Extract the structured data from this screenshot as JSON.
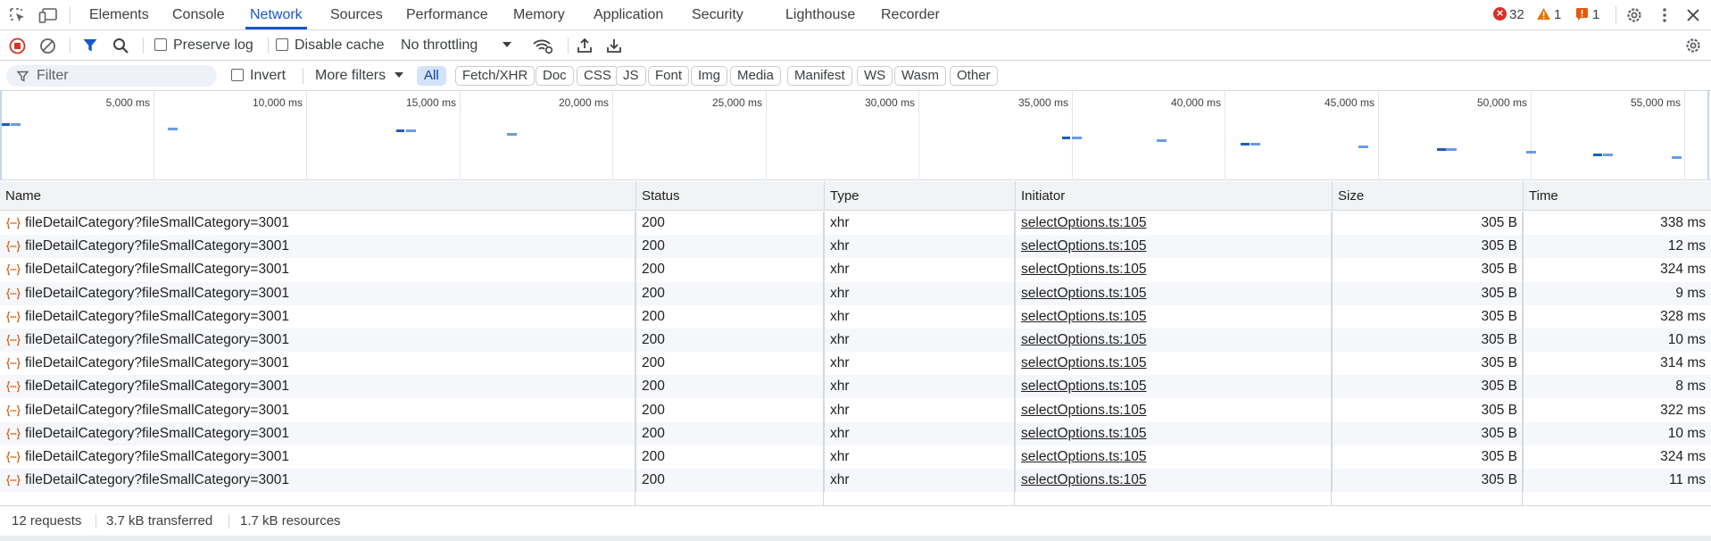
{
  "tabs": [
    {
      "label": "Elements"
    },
    {
      "label": "Console"
    },
    {
      "label": "Network",
      "active": true
    },
    {
      "label": "Sources"
    },
    {
      "label": "Performance"
    },
    {
      "label": "Memory"
    },
    {
      "label": "Application"
    },
    {
      "label": "Security"
    },
    {
      "label": "Lighthouse"
    },
    {
      "label": "Recorder"
    }
  ],
  "issues": {
    "errors": "32",
    "warnings": "1",
    "info": "1"
  },
  "toolbar": {
    "preserve_log": "Preserve log",
    "disable_cache": "Disable cache",
    "throttling": "No throttling"
  },
  "filter": {
    "placeholder": "Filter",
    "invert": "Invert",
    "more_filters": "More filters",
    "types": [
      "All",
      "Fetch/XHR",
      "Doc",
      "CSS",
      "JS",
      "Font",
      "Img",
      "Media",
      "Manifest",
      "WS",
      "Wasm",
      "Other"
    ],
    "active_type": "All"
  },
  "overview": {
    "ticks": [
      "5,000 ms",
      "10,000 ms",
      "15,000 ms",
      "20,000 ms",
      "25,000 ms",
      "30,000 ms",
      "35,000 ms",
      "40,000 ms",
      "45,000 ms",
      "50,000 ms",
      "55,000 ms"
    ]
  },
  "columns": {
    "name": "Name",
    "status": "Status",
    "type": "Type",
    "initiator": "Initiator",
    "size": "Size",
    "time": "Time"
  },
  "requests": [
    {
      "name": "fileDetailCategory?fileSmallCategory=3001",
      "status": "200",
      "type": "xhr",
      "initiator": "selectOptions.ts:105",
      "size": "305 B",
      "time": "338 ms"
    },
    {
      "name": "fileDetailCategory?fileSmallCategory=3001",
      "status": "200",
      "type": "xhr",
      "initiator": "selectOptions.ts:105",
      "size": "305 B",
      "time": "12 ms"
    },
    {
      "name": "fileDetailCategory?fileSmallCategory=3001",
      "status": "200",
      "type": "xhr",
      "initiator": "selectOptions.ts:105",
      "size": "305 B",
      "time": "324 ms"
    },
    {
      "name": "fileDetailCategory?fileSmallCategory=3001",
      "status": "200",
      "type": "xhr",
      "initiator": "selectOptions.ts:105",
      "size": "305 B",
      "time": "9 ms"
    },
    {
      "name": "fileDetailCategory?fileSmallCategory=3001",
      "status": "200",
      "type": "xhr",
      "initiator": "selectOptions.ts:105",
      "size": "305 B",
      "time": "328 ms"
    },
    {
      "name": "fileDetailCategory?fileSmallCategory=3001",
      "status": "200",
      "type": "xhr",
      "initiator": "selectOptions.ts:105",
      "size": "305 B",
      "time": "10 ms"
    },
    {
      "name": "fileDetailCategory?fileSmallCategory=3001",
      "status": "200",
      "type": "xhr",
      "initiator": "selectOptions.ts:105",
      "size": "305 B",
      "time": "314 ms"
    },
    {
      "name": "fileDetailCategory?fileSmallCategory=3001",
      "status": "200",
      "type": "xhr",
      "initiator": "selectOptions.ts:105",
      "size": "305 B",
      "time": "8 ms"
    },
    {
      "name": "fileDetailCategory?fileSmallCategory=3001",
      "status": "200",
      "type": "xhr",
      "initiator": "selectOptions.ts:105",
      "size": "305 B",
      "time": "322 ms"
    },
    {
      "name": "fileDetailCategory?fileSmallCategory=3001",
      "status": "200",
      "type": "xhr",
      "initiator": "selectOptions.ts:105",
      "size": "305 B",
      "time": "10 ms"
    },
    {
      "name": "fileDetailCategory?fileSmallCategory=3001",
      "status": "200",
      "type": "xhr",
      "initiator": "selectOptions.ts:105",
      "size": "305 B",
      "time": "324 ms"
    },
    {
      "name": "fileDetailCategory?fileSmallCategory=3001",
      "status": "200",
      "type": "xhr",
      "initiator": "selectOptions.ts:105",
      "size": "305 B",
      "time": "11 ms"
    }
  ],
  "summary": {
    "requests": "12 requests",
    "transferred": "3.7 kB transferred",
    "resources": "1.7 kB resources"
  },
  "colors": {
    "accent": "#1a56c9",
    "error": "#d93025",
    "warning": "#e37400",
    "xhr_icon": "#d56b1f"
  }
}
